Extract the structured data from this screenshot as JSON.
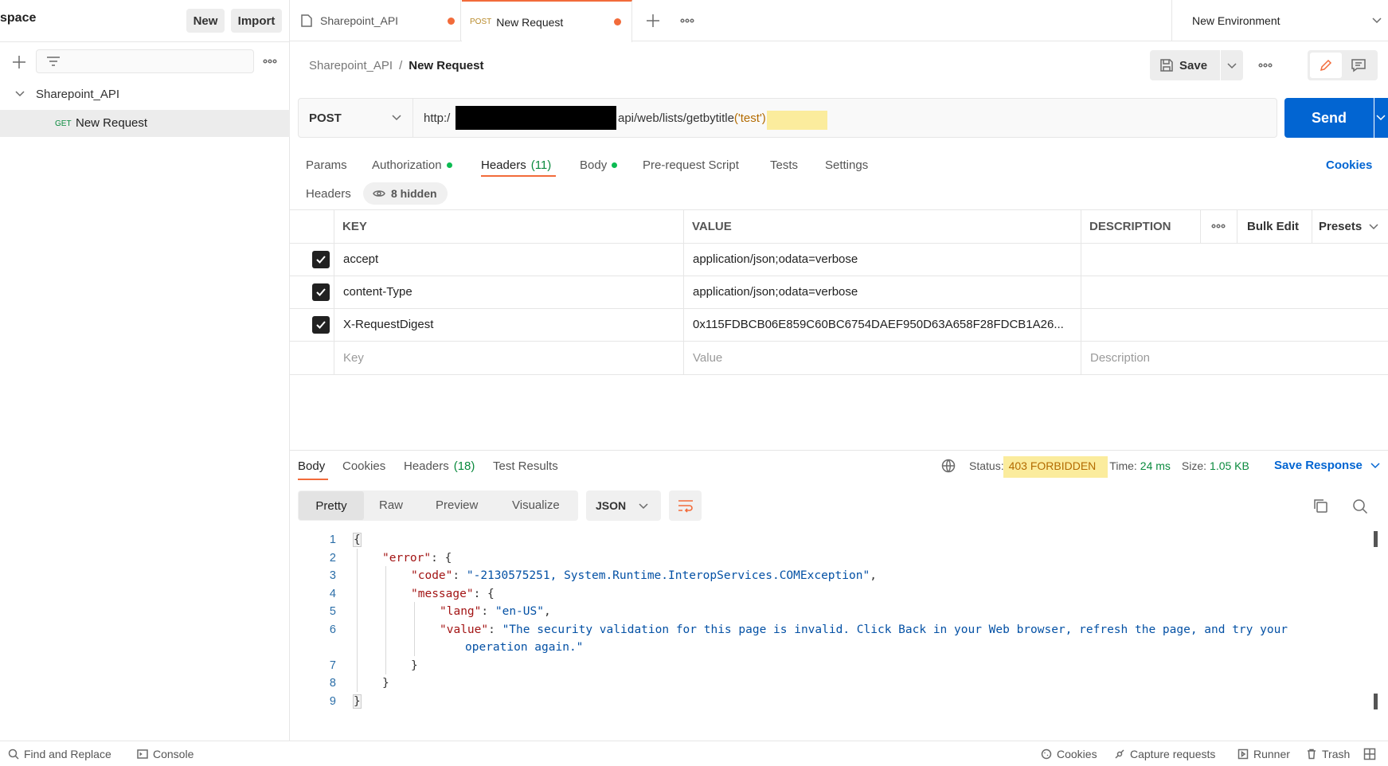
{
  "sidebar": {
    "workspace_title": "space",
    "new_label": "New",
    "import_label": "Import",
    "collection_name": "Sharepoint_API",
    "request_method": "GET",
    "request_name": "New Request"
  },
  "tabs": [
    {
      "label": "Sharepoint_API"
    },
    {
      "method": "POST",
      "label": "New Request"
    }
  ],
  "environment": "New Environment",
  "breadcrumb": {
    "collection": "Sharepoint_API",
    "separator": "/",
    "request": "New Request"
  },
  "save_label": "Save",
  "request": {
    "method": "POST",
    "url_prefix": "http:/",
    "url_suffix": "api/web/lists/getbytitle",
    "url_highlight": "('test')",
    "send_label": "Send"
  },
  "request_tabs": {
    "params": "Params",
    "authorization": "Authorization",
    "headers": "Headers",
    "headers_count": "(11)",
    "body": "Body",
    "prerequest": "Pre-request Script",
    "tests": "Tests",
    "settings": "Settings",
    "cookies": "Cookies"
  },
  "headers_section": {
    "label": "Headers",
    "hidden": "8 hidden"
  },
  "headers_table": {
    "col_key": "KEY",
    "col_value": "VALUE",
    "col_description": "DESCRIPTION",
    "bulk_edit": "Bulk Edit",
    "presets": "Presets",
    "rows": [
      {
        "key": "accept",
        "value": "application/json;odata=verbose"
      },
      {
        "key": "content-Type",
        "value": "application/json;odata=verbose"
      },
      {
        "key": "X-RequestDigest",
        "value": "0x115FDBCB06E859C60BC6754DAEF950D63A658F28FDCB1A26..."
      }
    ],
    "placeholder_key": "Key",
    "placeholder_value": "Value",
    "placeholder_description": "Description"
  },
  "response": {
    "tabs": {
      "body": "Body",
      "cookies": "Cookies",
      "headers": "Headers",
      "headers_count": "(18)",
      "test_results": "Test Results"
    },
    "status_label": "Status:",
    "status_value": "403 FORBIDDEN",
    "time_label": "Time:",
    "time_value": "24 ms",
    "size_label": "Size:",
    "size_value": "1.05 KB",
    "save_response": "Save Response",
    "view_modes": {
      "pretty": "Pretty",
      "raw": "Raw",
      "preview": "Preview",
      "visualize": "Visualize"
    },
    "format": "JSON",
    "line_numbers": [
      "1",
      "2",
      "3",
      "4",
      "5",
      "6",
      "7",
      "8",
      "9"
    ],
    "code": {
      "l1": "{",
      "l2_key": "\"error\"",
      "l2_rest": ": {",
      "l3_key": "\"code\"",
      "l3_val": "\"-2130575251, System.Runtime.InteropServices.COMException\"",
      "l3_end": ",",
      "l4_key": "\"message\"",
      "l4_rest": ": {",
      "l5_key": "\"lang\"",
      "l5_val": "\"en-US\"",
      "l5_end": ",",
      "l6_key": "\"value\"",
      "l6_val": "\"The security validation for this page is invalid. Click Back in your Web browser, refresh the page, and try your",
      "l6_cont": "operation again.\"",
      "l7": "}",
      "l8": "}",
      "l9": "}",
      "colon": ": "
    }
  },
  "footer": {
    "find_replace": "Find and Replace",
    "console": "Console",
    "cookies": "Cookies",
    "capture": "Capture requests",
    "runner": "Runner",
    "trash": "Trash"
  },
  "colors": {
    "accent": "#0265d2",
    "orange": "#f26b3a",
    "highlight": "#fbec9d",
    "status_green": "#0a8a3e"
  }
}
